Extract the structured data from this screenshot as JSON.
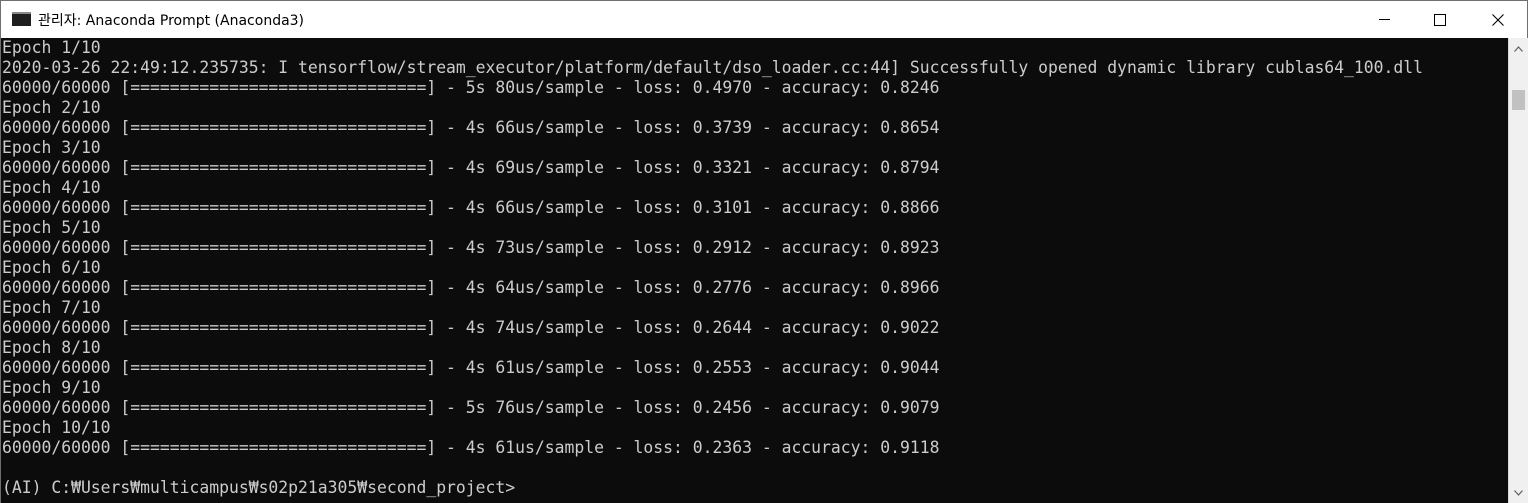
{
  "window": {
    "title": "관리자: Anaconda Prompt (Anaconda3)",
    "icon": "console-window-icon"
  },
  "controls": {
    "minimize": "minimize-icon",
    "maximize": "maximize-icon",
    "close": "close-icon"
  },
  "console": {
    "lines": [
      "Epoch 1/10",
      "2020-03-26 22:49:12.235735: I tensorflow/stream_executor/platform/default/dso_loader.cc:44] Successfully opened dynamic library cublas64_100.dll",
      "60000/60000 [==============================] - 5s 80us/sample - loss: 0.4970 - accuracy: 0.8246",
      "Epoch 2/10",
      "60000/60000 [==============================] - 4s 66us/sample - loss: 0.3739 - accuracy: 0.8654",
      "Epoch 3/10",
      "60000/60000 [==============================] - 4s 69us/sample - loss: 0.3321 - accuracy: 0.8794",
      "Epoch 4/10",
      "60000/60000 [==============================] - 4s 66us/sample - loss: 0.3101 - accuracy: 0.8866",
      "Epoch 5/10",
      "60000/60000 [==============================] - 4s 73us/sample - loss: 0.2912 - accuracy: 0.8923",
      "Epoch 6/10",
      "60000/60000 [==============================] - 4s 64us/sample - loss: 0.2776 - accuracy: 0.8966",
      "Epoch 7/10",
      "60000/60000 [==============================] - 4s 74us/sample - loss: 0.2644 - accuracy: 0.9022",
      "Epoch 8/10",
      "60000/60000 [==============================] - 4s 61us/sample - loss: 0.2553 - accuracy: 0.9044",
      "Epoch 9/10",
      "60000/60000 [==============================] - 5s 76us/sample - loss: 0.2456 - accuracy: 0.9079",
      "Epoch 10/10",
      "60000/60000 [==============================] - 4s 61us/sample - loss: 0.2363 - accuracy: 0.9118",
      "",
      "(AI) C:₩Users₩multicampus₩s02p21a305₩second_project>"
    ],
    "text_color": "#cccccc",
    "background_color": "#0c0c0c"
  },
  "scrollbar": {
    "up_icon": "scroll-up-arrow-icon",
    "down_icon": "scroll-down-arrow-icon"
  }
}
